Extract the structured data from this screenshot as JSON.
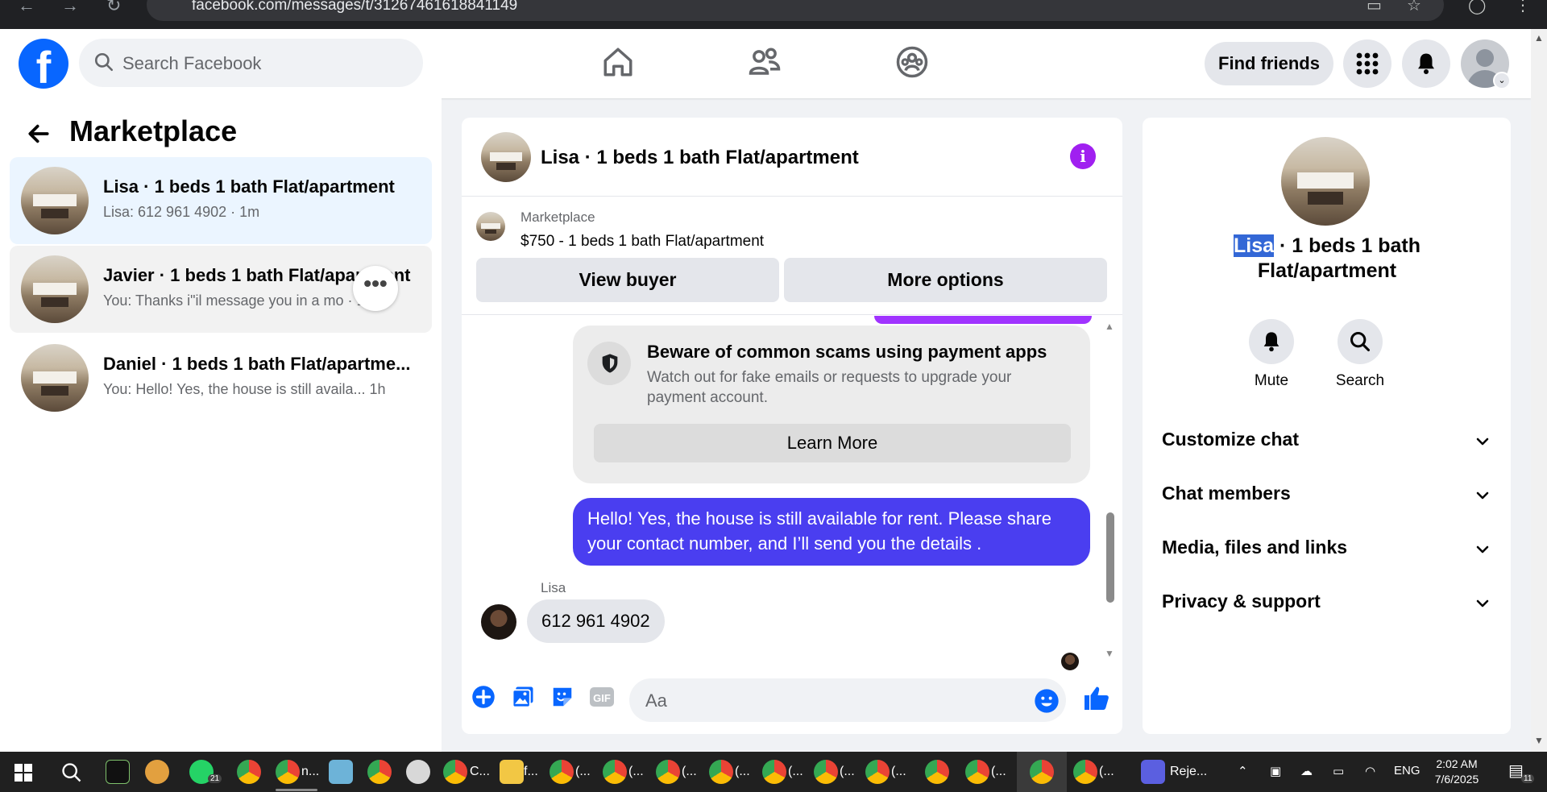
{
  "browser": {
    "url": "facebook.com/messages/t/31267461618841149"
  },
  "topbar": {
    "logo": "f",
    "search_placeholder": "Search Facebook",
    "find_friends": "Find friends"
  },
  "sidebar": {
    "title": "Marketplace",
    "conversations": [
      {
        "title": "Lisa · 1 beds 1 bath Flat/apartment",
        "preview": "Lisa: 612 961 4902 · 1m",
        "active": true
      },
      {
        "title": "Javier · 1 beds 1 bath Flat/apartment",
        "preview": "You: Thanks i\"il message you in a mo · 1h",
        "active": false
      },
      {
        "title": "Daniel · 1 beds 1 bath Flat/apartme...",
        "preview": "You: Hello! Yes, the house is still availa...  1h",
        "active": false
      }
    ]
  },
  "chat": {
    "title": "Lisa · 1 beds 1 bath Flat/apartment",
    "listing_source": "Marketplace",
    "listing_price": "$750 - 1 beds 1 bath Flat/apartment",
    "view_buyer": "View buyer",
    "more_options": "More options",
    "scam_title": "Beware of common scams using payment apps",
    "scam_body": "Watch out for fake emails or requests to upgrade your payment account.",
    "learn_more": "Learn More",
    "my_message": "Hello! Yes, the house is still available for rent. Please share your contact number, and I’ll send you the details .",
    "sender_name": "Lisa",
    "their_message": "612 961 4902",
    "composer_placeholder": "Aa",
    "gif_label": "GIF"
  },
  "details": {
    "title_highlight": "Lisa",
    "title_rest": " · 1 beds 1 bath Flat/apartment",
    "mute": "Mute",
    "search": "Search",
    "sections": [
      "Customize chat",
      "Chat members",
      "Media, files and links",
      "Privacy & support"
    ]
  },
  "taskbar": {
    "whatsapp_badge": "21",
    "labels": [
      "n...",
      "C...",
      "f...",
      "(...",
      "(...",
      "(...",
      "(...",
      "(...",
      "(...",
      "(...",
      "(...",
      "(...",
      "Reje..."
    ],
    "lang": "ENG",
    "time": "2:02 AM",
    "date": "7/6/2025",
    "notif_badge": "11"
  },
  "colors": {
    "fb_blue": "#0866ff",
    "my_bubble": "#4a3ef0",
    "info_purple": "#a020f0",
    "active_conv": "#ebf5ff"
  }
}
